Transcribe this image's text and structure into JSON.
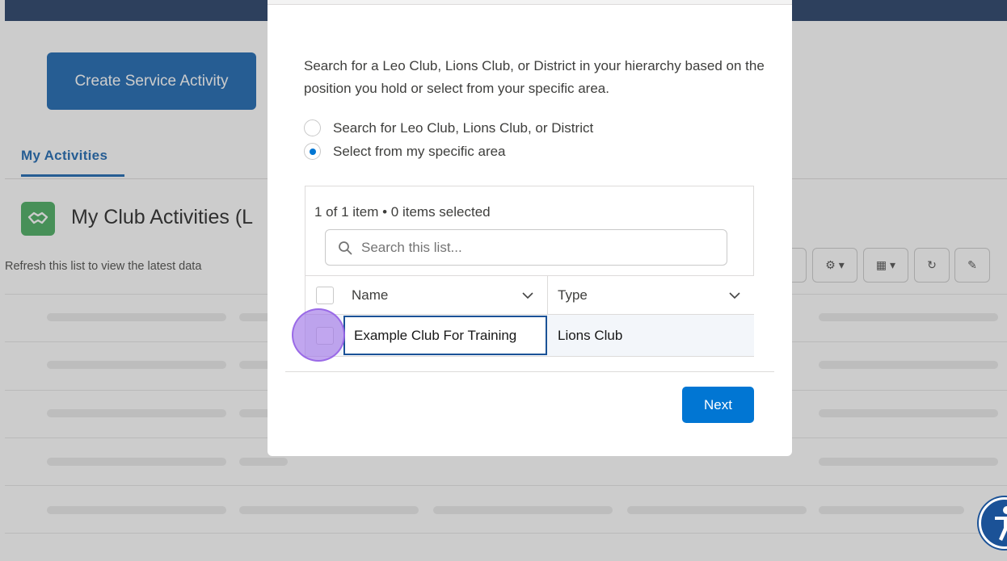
{
  "background": {
    "create_button": "Create Service Activity",
    "tab_label": "My Activities",
    "list_title": "My Club Activities (L",
    "refresh_text": "Refresh this list to view the latest data",
    "toolbar_icons": [
      "gear-icon",
      "table-icon",
      "refresh-icon",
      "pencil-icon"
    ]
  },
  "modal": {
    "intro": "Search for a Leo Club, Lions Club, or District in your hierarchy based on the position you hold or select from your specific area.",
    "radio_options": [
      {
        "label": "Search for Leo Club, Lions Club, or District",
        "checked": false
      },
      {
        "label": "Select from my specific area",
        "checked": true
      }
    ],
    "table": {
      "count_text": "1 of 1 item • 0 items selected",
      "search_placeholder": "Search this list...",
      "columns": [
        "Name",
        "Type"
      ],
      "rows": [
        {
          "name": "Example Club For Training",
          "type": "Lions Club"
        }
      ]
    },
    "next_button": "Next"
  },
  "colors": {
    "brand_blue": "#0176d3",
    "header_navy": "#16325c",
    "highlight": "#a076e6"
  }
}
